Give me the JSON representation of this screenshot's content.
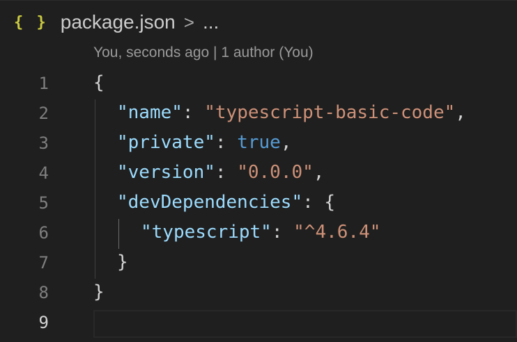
{
  "breadcrumb": {
    "icon": "{ }",
    "file": "package.json",
    "separator": ">",
    "more": "..."
  },
  "codelens": "You, seconds ago | 1 author (You)",
  "lines": [
    {
      "num": "1"
    },
    {
      "num": "2",
      "key": "\"name\"",
      "colon": ": ",
      "value": "\"typescript-basic-code\"",
      "end": ","
    },
    {
      "num": "3",
      "key": "\"private\"",
      "colon": ": ",
      "value": "true",
      "end": ","
    },
    {
      "num": "4",
      "key": "\"version\"",
      "colon": ": ",
      "value": "\"0.0.0\"",
      "end": ","
    },
    {
      "num": "5",
      "key": "\"devDependencies\"",
      "colon": ": ",
      "value": "{"
    },
    {
      "num": "6",
      "key": "\"typescript\"",
      "colon": ": ",
      "value": "\"^4.6.4\""
    },
    {
      "num": "7",
      "value": "}"
    },
    {
      "num": "8",
      "value": "}"
    },
    {
      "num": "9"
    }
  ],
  "line1_text": "{",
  "colors": {
    "background": "#1f1f1f",
    "key": "#9cdcfe",
    "string": "#ce9178",
    "boolean": "#569cd6",
    "icon": "#cbcb41"
  }
}
